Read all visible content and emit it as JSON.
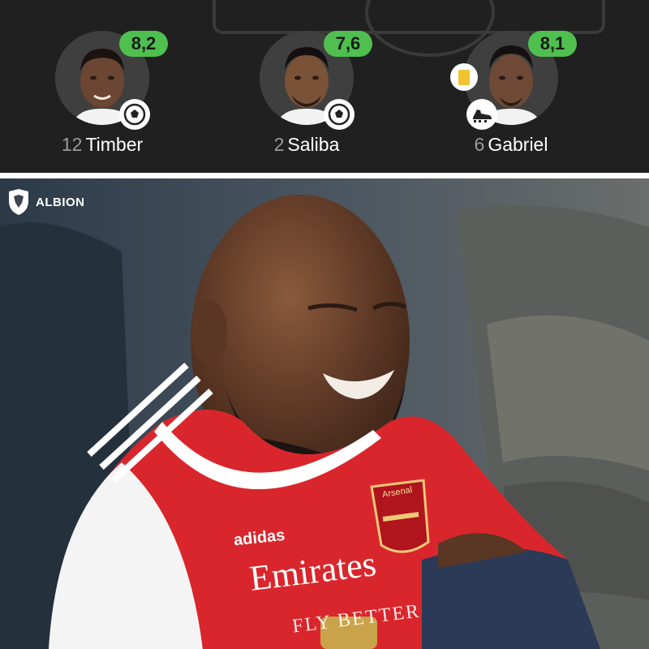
{
  "lineup": {
    "players": [
      {
        "number": "12",
        "name": "Timber",
        "rating": "8,2",
        "rating_color": "#4fbf4f",
        "badge_icon": "football-icon"
      },
      {
        "number": "2",
        "name": "Saliba",
        "rating": "7,6",
        "rating_color": "#4fbf4f",
        "badge_icon": "football-icon"
      },
      {
        "number": "6",
        "name": "Gabriel",
        "rating": "8,1",
        "rating_color": "#4fbf4f",
        "badge_icon": "boot-icon",
        "card_icon": "yellow-card-icon"
      }
    ]
  },
  "photo": {
    "watermark": "ALBION",
    "shirt_brand": "adidas",
    "shirt_sponsor": "Emirates",
    "shirt_sponsor_sub": "FLY BETTER",
    "crest_text": "Arsenal",
    "colors": {
      "shirt_red": "#d9262c",
      "shirt_white": "#f4f4f4",
      "background": "#3c4650"
    }
  }
}
